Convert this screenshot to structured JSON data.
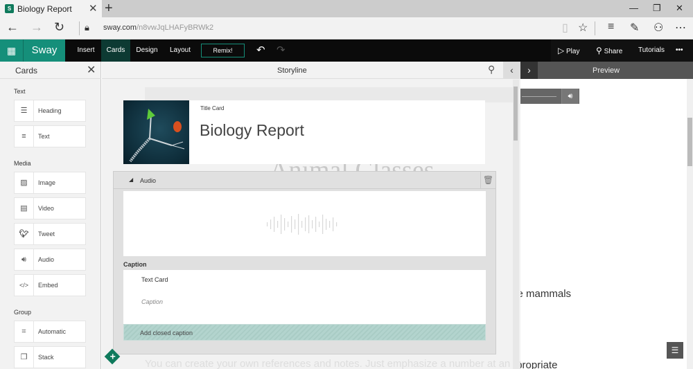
{
  "browser": {
    "tab_title": "Biology Report",
    "tab_icon_text": "S",
    "url_host": "sway.com",
    "url_path": "/n8vwJqLHAFyBRWk2"
  },
  "toolbar": {
    "brand": "Sway",
    "menu": [
      "Insert",
      "Cards",
      "Design",
      "Layout"
    ],
    "active_menu": "Cards",
    "remix_label": "Remix!",
    "play_label": "Play",
    "share_label": "Share",
    "tutorials_label": "Tutorials",
    "more_label": "•••"
  },
  "cards_panel": {
    "title": "Cards",
    "groups": [
      {
        "label": "Text",
        "items": [
          {
            "label": "Heading",
            "icon": "heading-icon"
          },
          {
            "label": "Text",
            "icon": "text-icon"
          }
        ]
      },
      {
        "label": "Media",
        "items": [
          {
            "label": "Image",
            "icon": "image-icon"
          },
          {
            "label": "Video",
            "icon": "video-icon"
          },
          {
            "label": "Tweet",
            "icon": "twitter-icon"
          },
          {
            "label": "Audio",
            "icon": "audio-icon"
          },
          {
            "label": "Embed",
            "icon": "embed-icon"
          }
        ]
      },
      {
        "label": "Group",
        "items": [
          {
            "label": "Automatic",
            "icon": "automatic-icon"
          },
          {
            "label": "Stack",
            "icon": "stack-icon"
          }
        ]
      }
    ]
  },
  "storyline": {
    "title": "Storyline",
    "title_card": {
      "type_label": "Title Card",
      "heading": "Biology Report"
    },
    "audio_card": {
      "header": "Audio",
      "caption_label": "Caption",
      "caption_card_type": "Text Card",
      "caption_placeholder": "Caption",
      "closed_caption_label": "Add closed caption"
    },
    "ghost_heading": "Animal Classes",
    "ghost_text": "You can create your own references and notes. Just emphasize a number at an appropriate"
  },
  "preview": {
    "title": "Preview",
    "text_line1": "s. Female mammals",
    "text_line2": "at an appropriate"
  }
}
